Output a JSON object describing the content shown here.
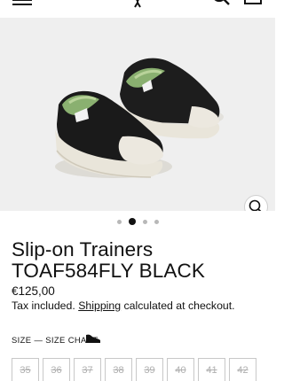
{
  "header": {
    "menu_icon": "hamburger-icon",
    "logo_icon": "brand-logo-icon",
    "search_icon": "search-icon",
    "cart_icon": "bag-icon"
  },
  "gallery": {
    "dots": [
      {
        "active": false
      },
      {
        "active": true
      },
      {
        "active": false
      },
      {
        "active": false
      }
    ],
    "zoom_icon": "magnifier-icon",
    "colors": {
      "background": "#efefef",
      "upper": "#1a1a1a",
      "toe_cap": "#ece8df",
      "lining": "#8ab070"
    }
  },
  "product": {
    "title_line1": "Slip-on Trainers",
    "title_line2": "TOAF584FLY BLACK",
    "price": "€125,00",
    "tax_prefix": "Tax included.",
    "shipping_link": "Shipping",
    "tax_suffix": "calculated at checkout."
  },
  "size": {
    "label": "SIZE",
    "dash": "—",
    "chart_link": "SIZE CHART",
    "chart_icon": "shoe-icon",
    "options": [
      "35",
      "36",
      "37",
      "38",
      "39",
      "40",
      "41",
      "42"
    ]
  }
}
